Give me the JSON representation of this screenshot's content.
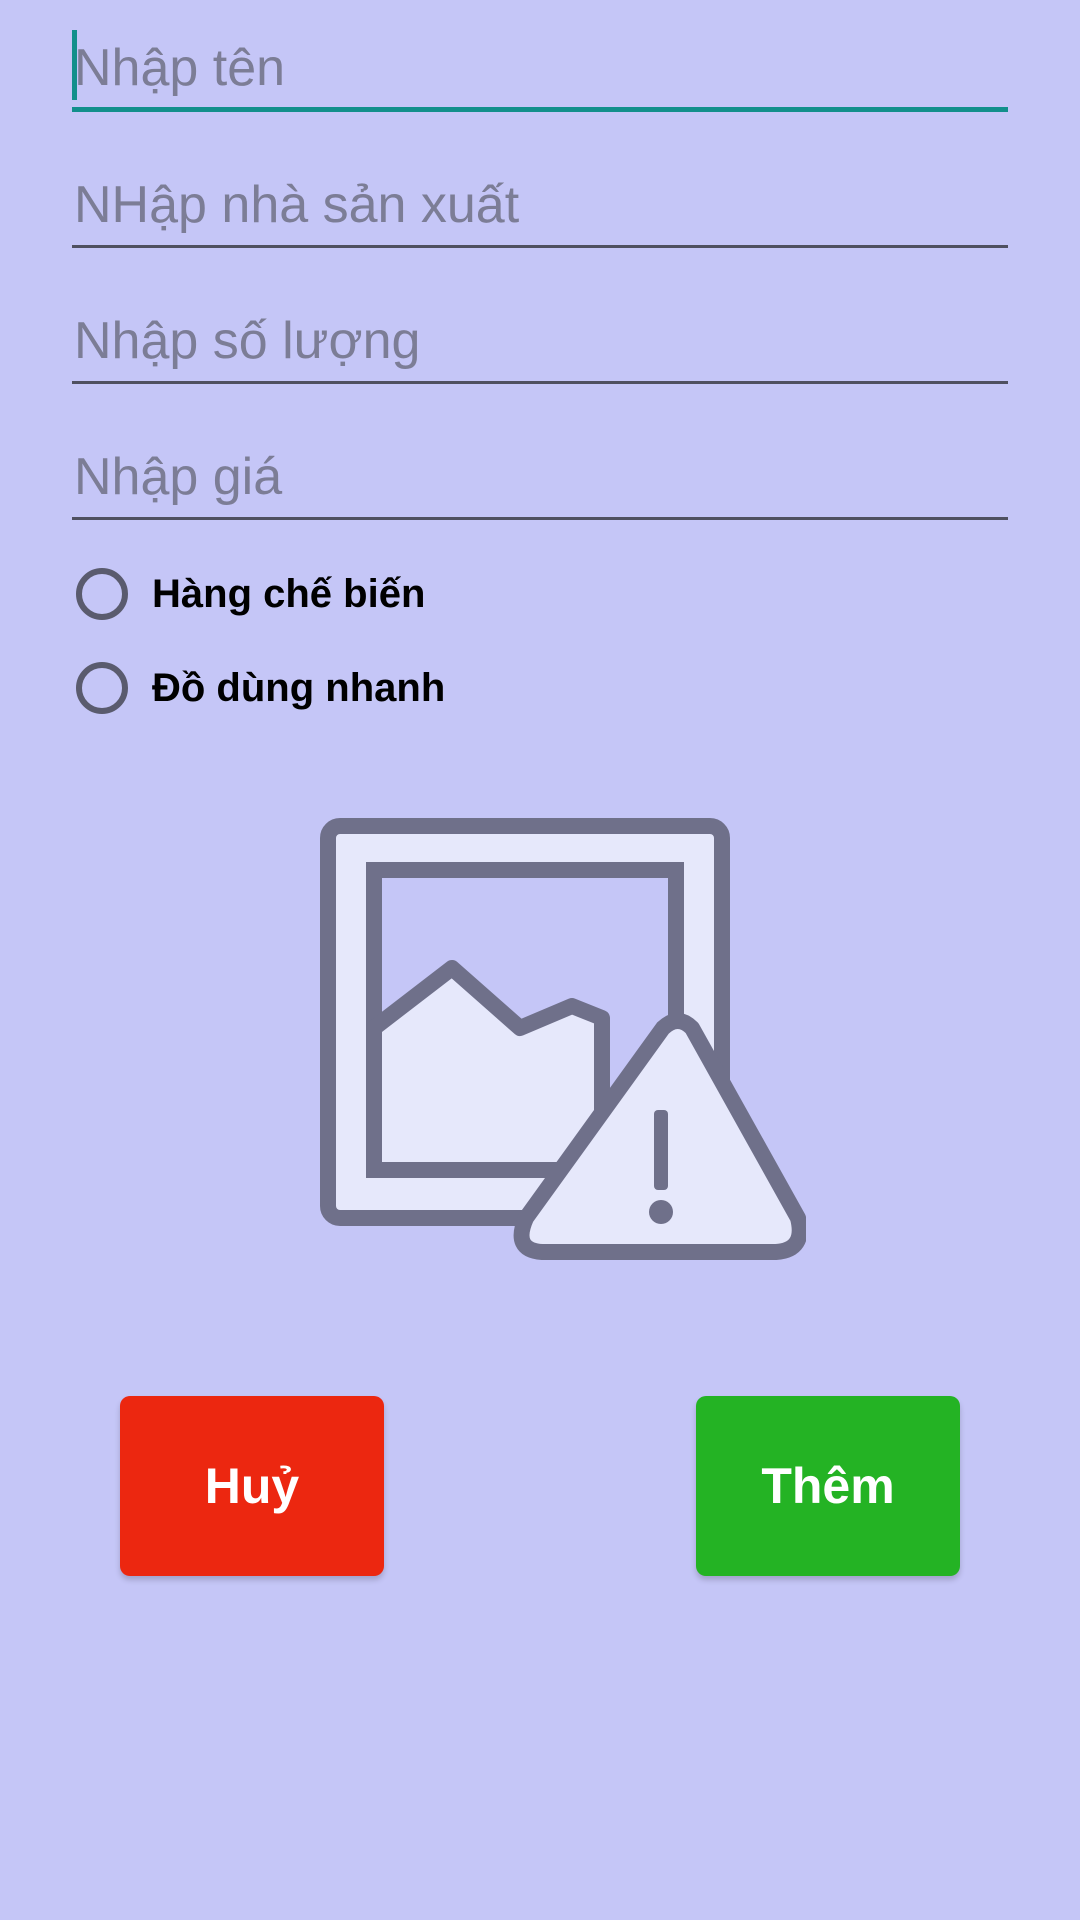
{
  "form": {
    "name_placeholder": "Nhập tên",
    "manufacturer_placeholder": "NHập nhà sản xuất",
    "quantity_placeholder": "Nhập số lượng",
    "price_placeholder": "Nhập giá",
    "name_value": "",
    "manufacturer_value": "",
    "quantity_value": "",
    "price_value": ""
  },
  "category": {
    "options": [
      {
        "label": "Hàng chế biến",
        "selected": false
      },
      {
        "label": "Đồ dùng nhanh",
        "selected": false
      }
    ]
  },
  "image": {
    "icon": "broken-image-icon"
  },
  "buttons": {
    "cancel_label": "Huỷ",
    "add_label": "Thêm"
  },
  "colors": {
    "background": "#c5c6f7",
    "accent": "#128f8b",
    "cancel": "#ec2710",
    "add": "#24b324"
  }
}
